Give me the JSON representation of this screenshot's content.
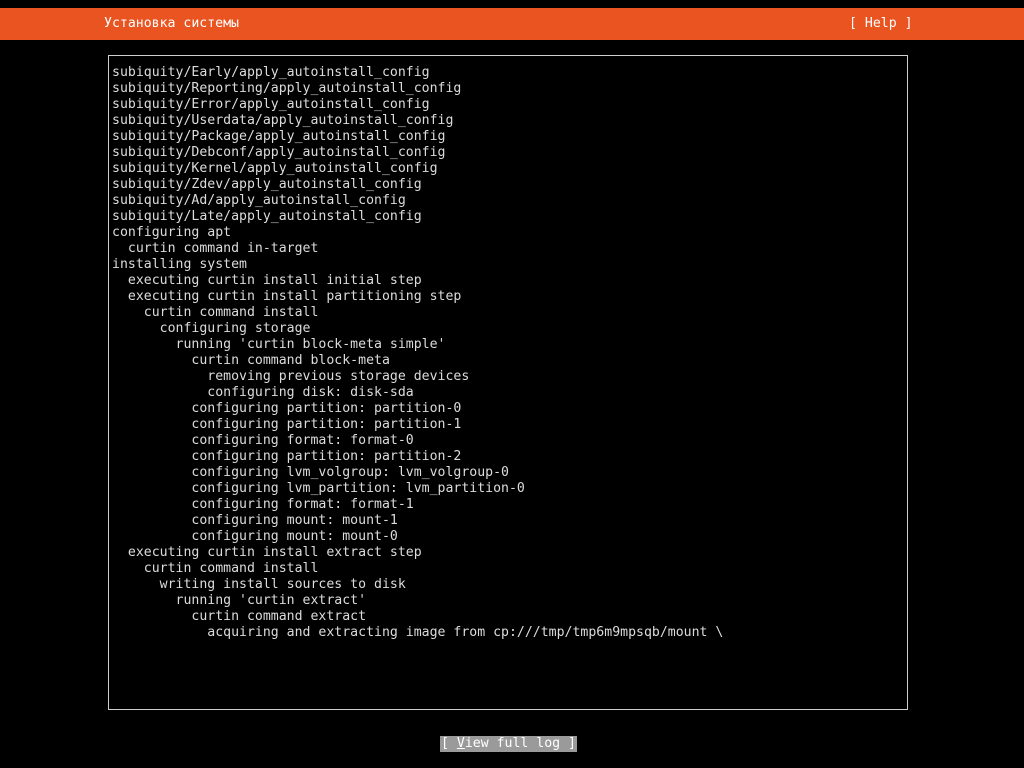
{
  "header": {
    "title": "Установка системы",
    "help_label": "[ Help ]"
  },
  "log": {
    "lines": [
      "subiquity/Early/apply_autoinstall_config",
      "subiquity/Reporting/apply_autoinstall_config",
      "subiquity/Error/apply_autoinstall_config",
      "subiquity/Userdata/apply_autoinstall_config",
      "subiquity/Package/apply_autoinstall_config",
      "subiquity/Debconf/apply_autoinstall_config",
      "subiquity/Kernel/apply_autoinstall_config",
      "subiquity/Zdev/apply_autoinstall_config",
      "subiquity/Ad/apply_autoinstall_config",
      "subiquity/Late/apply_autoinstall_config",
      "configuring apt",
      "  curtin command in-target",
      "installing system",
      "  executing curtin install initial step",
      "  executing curtin install partitioning step",
      "    curtin command install",
      "      configuring storage",
      "        running 'curtin block-meta simple'",
      "          curtin command block-meta",
      "            removing previous storage devices",
      "            configuring disk: disk-sda",
      "          configuring partition: partition-0",
      "          configuring partition: partition-1",
      "          configuring format: format-0",
      "          configuring partition: partition-2",
      "          configuring lvm_volgroup: lvm_volgroup-0",
      "          configuring lvm_partition: lvm_partition-0",
      "          configuring format: format-1",
      "          configuring mount: mount-1",
      "          configuring mount: mount-0",
      "  executing curtin install extract step",
      "    curtin command install",
      "      writing install sources to disk",
      "        running 'curtin extract'",
      "          curtin command extract",
      "            acquiring and extracting image from cp:///tmp/tmp6m9mpsqb/mount \\"
    ]
  },
  "footer": {
    "view_log_prefix": "[ ",
    "view_log_hotkey": "V",
    "view_log_rest": "iew full log ]"
  },
  "colors": {
    "header_bg": "#e95420",
    "background": "#000000",
    "text": "#dcdcdc",
    "button_bg": "#9a9a9a"
  }
}
